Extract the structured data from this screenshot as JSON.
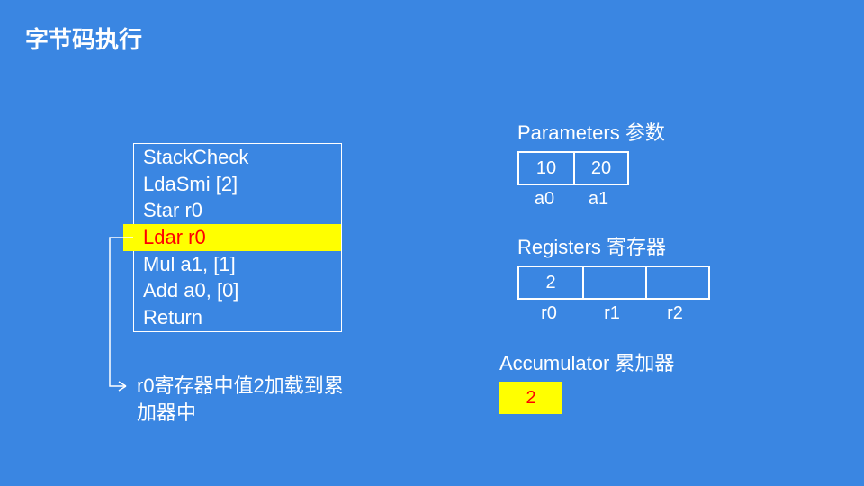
{
  "title": "字节码执行",
  "bytecode": {
    "lines": [
      {
        "text": "StackCheck",
        "highlight": false
      },
      {
        "text": "LdaSmi [2]",
        "highlight": false
      },
      {
        "text": "Star r0",
        "highlight": false
      },
      {
        "text": "Ldar r0",
        "highlight": true
      },
      {
        "text": "Mul a1, [1]",
        "highlight": false
      },
      {
        "text": "Add a0, [0]",
        "highlight": false
      },
      {
        "text": "Return",
        "highlight": false
      }
    ]
  },
  "caption": "r0寄存器中值2加载到累加器中",
  "parameters": {
    "title": "Parameters 参数",
    "values": [
      "10",
      "20"
    ],
    "labels": [
      "a0",
      "a1"
    ]
  },
  "registers": {
    "title": "Registers 寄存器",
    "values": [
      "2",
      "",
      ""
    ],
    "labels": [
      "r0",
      "r1",
      "r2"
    ]
  },
  "accumulator": {
    "title": "Accumulator 累加器",
    "value": "2"
  }
}
